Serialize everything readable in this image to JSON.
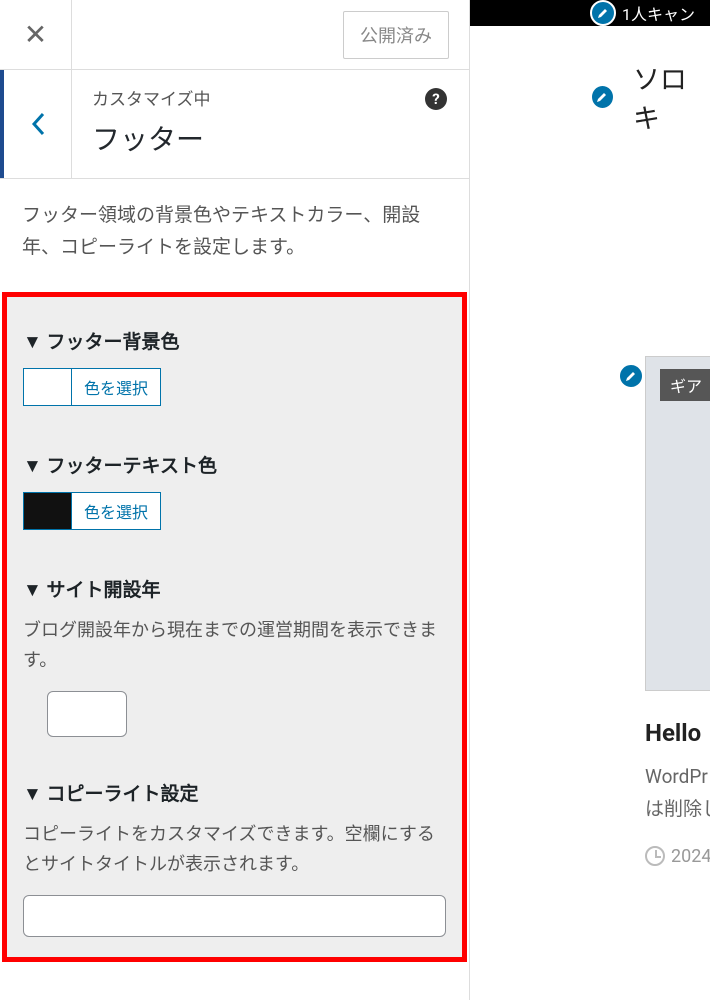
{
  "header": {
    "publish_label": "公開済み"
  },
  "section": {
    "customizing": "カスタマイズ中",
    "title": "フッター",
    "description": "フッター領域の背景色やテキストカラー、開設年、コピーライトを設定します。"
  },
  "controls": {
    "footer_bg": {
      "label": "▼ フッター背景色",
      "button": "色を選択"
    },
    "footer_text": {
      "label": "▼ フッターテキスト色",
      "button": "色を選択"
    },
    "site_year": {
      "label": "▼ サイト開設年",
      "desc": "ブログ開設年から現在までの運営期間を表示できます。",
      "value": ""
    },
    "copyright": {
      "label": "▼ コピーライト設定",
      "desc": "コピーライトをカスタマイズできます。空欄にするとサイトタイトルが表示されます。",
      "value": ""
    }
  },
  "preview": {
    "topbar": "1人キャン",
    "site_title": "ソロキ",
    "tag": "ギア",
    "post_title": "Hello",
    "post_excerpt1": "WordPr",
    "post_excerpt2": "は削除し",
    "date": "2024"
  }
}
